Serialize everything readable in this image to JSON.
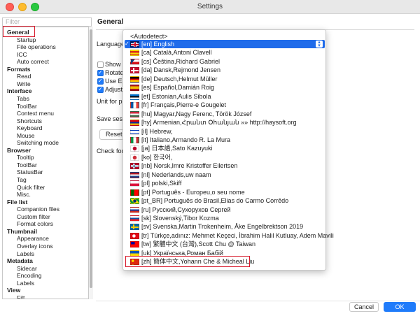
{
  "window": {
    "title": "Settings"
  },
  "filter": {
    "placeholder": "Filter"
  },
  "sidebar": {
    "items": [
      {
        "label": "General",
        "level": 0
      },
      {
        "label": "Startup",
        "level": 1
      },
      {
        "label": "File operations",
        "level": 1
      },
      {
        "label": "ICC",
        "level": 1
      },
      {
        "label": "Auto correct",
        "level": 1
      },
      {
        "label": "Formats",
        "level": 0
      },
      {
        "label": "Read",
        "level": 1
      },
      {
        "label": "Write",
        "level": 1
      },
      {
        "label": "Interface",
        "level": 0
      },
      {
        "label": "Tabs",
        "level": 1
      },
      {
        "label": "ToolBar",
        "level": 1
      },
      {
        "label": "Context menu",
        "level": 1
      },
      {
        "label": "Shortcuts",
        "level": 1
      },
      {
        "label": "Keyboard",
        "level": 1
      },
      {
        "label": "Mouse",
        "level": 1
      },
      {
        "label": "Switching mode",
        "level": 1
      },
      {
        "label": "Browser",
        "level": 0
      },
      {
        "label": "Tooltip",
        "level": 1
      },
      {
        "label": "ToolBar",
        "level": 1
      },
      {
        "label": "StatusBar",
        "level": 1
      },
      {
        "label": "Tag",
        "level": 1
      },
      {
        "label": "Quick filter",
        "level": 1
      },
      {
        "label": "Misc.",
        "level": 1
      },
      {
        "label": "File list",
        "level": 0
      },
      {
        "label": "Companion files",
        "level": 1
      },
      {
        "label": "Custom filter",
        "level": 1
      },
      {
        "label": "Format colors",
        "level": 1
      },
      {
        "label": "Thumbnail",
        "level": 0
      },
      {
        "label": "Appearance",
        "level": 1
      },
      {
        "label": "Overlay icons",
        "level": 1
      },
      {
        "label": "Labels",
        "level": 1
      },
      {
        "label": "Metadata",
        "level": 0
      },
      {
        "label": "Sidecar",
        "level": 1
      },
      {
        "label": "Encoding",
        "level": 1
      },
      {
        "label": "Labels",
        "level": 1
      },
      {
        "label": "View",
        "level": 0
      },
      {
        "label": "Filt...",
        "level": 1
      }
    ]
  },
  "main": {
    "title": "General",
    "language_label": "Language",
    "show_label": "Show",
    "rotate_label": "Rotate",
    "use_label": "Use EX",
    "adjust_label": "Adjust",
    "unit_label": "Unit for p",
    "save_label": "Save ses",
    "reset_label": "Reset",
    "check_label": "Check for"
  },
  "language_dropdown": {
    "autodetect": "<Autodetect>",
    "options": [
      {
        "label": "[en] English",
        "flag": "gb",
        "selected": true
      },
      {
        "label": "[ca] Català,Antoni Clavell",
        "flag": "ca"
      },
      {
        "label": "[cs] Čeština,Richard Gabriel",
        "flag": "cz"
      },
      {
        "label": "[da] Dansk,Rejmond Jensen",
        "flag": "dk"
      },
      {
        "label": "[de] Deutsch,Helmut Müller",
        "flag": "de"
      },
      {
        "label": "[es] Español,Damián Roig",
        "flag": "es"
      },
      {
        "label": "[et] Estonian,Aulis Sibola",
        "flag": "ee"
      },
      {
        "label": "[fr] Français,Pierre-e Gougelet",
        "flag": "fr"
      },
      {
        "label": "[hu] Magyar,Nagy Ferenc, Török József",
        "flag": "hu"
      },
      {
        "label": "[hy] Armenian,Հրանտ Օհանյան »» http://haysoft.org",
        "flag": "am"
      },
      {
        "label": "[il] Hebrew,",
        "flag": "il"
      },
      {
        "label": "[it] Italiano,Armando R. La Mura",
        "flag": "it"
      },
      {
        "label": "[ja] 日本語,Sato Kazuyuki",
        "flag": "jp"
      },
      {
        "label": "[ko] 한국어,",
        "flag": "kr"
      },
      {
        "label": "[nb] Norsk,Imre Kristoffer Eilertsen",
        "flag": "no"
      },
      {
        "label": "[nl] Nederlands,uw naam",
        "flag": "nl"
      },
      {
        "label": "[pl] polski,Skiff",
        "flag": "pl"
      },
      {
        "label": "[pt] Português - Europeu,o seu nome",
        "flag": "pt"
      },
      {
        "label": "[pt_BR] Português do Brasil,Elias do Carmo Corrêdo",
        "flag": "br"
      },
      {
        "label": "[ru] Русский,Сухорухов Сергей",
        "flag": "ru"
      },
      {
        "label": "[sk] Slovenský,Tibor Kozma",
        "flag": "sk"
      },
      {
        "label": "[sv] Svenska,Martin Trokenheim, Åke Engelbrektson 2019",
        "flag": "se"
      },
      {
        "label": "[tr] Türkçe,adınız: Mehmet Keçeci, İbrahim Halil Kutluay, Adem Mavili",
        "flag": "tr"
      },
      {
        "label": "[tw] 繁體中文 (台灣),Scott Chu @ Taiwan",
        "flag": "tw"
      },
      {
        "label": "[uk] Українська,Роман Бабій",
        "flag": "ua"
      },
      {
        "label": "[zh] 簡体中文,Yohann Che & Micheal Liu",
        "flag": "cn",
        "highlighted": true
      }
    ]
  },
  "footer": {
    "cancel_label": "Cancel",
    "ok_label": "OK"
  },
  "colors": {
    "accent": "#1f7bfa",
    "highlight_box": "#d7192b",
    "selection": "#1f6bea"
  }
}
